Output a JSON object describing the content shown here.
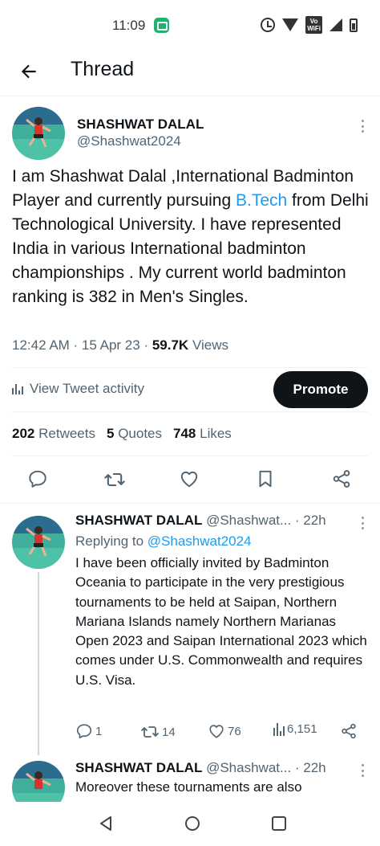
{
  "status_bar": {
    "time": "11:09",
    "vowifi_line1": "Vo",
    "vowifi_line2": "WiFi"
  },
  "header": {
    "title": "Thread"
  },
  "main_tweet": {
    "author_name": "SHASHWAT DALAL",
    "handle": "@Shashwat2024",
    "text_before_link": "I am Shashwat Dalal ,International Badminton Player and currently pursuing ",
    "link_text": "B.Tech",
    "text_after_link": " from Delhi Technological University. I have represented India in various International badminton championships . My current world badminton ranking is 382 in Men's Singles.",
    "timestamp": "12:42 AM · 15 Apr 23 · ",
    "views_count": "59.7K",
    "views_label": "Views",
    "activity_label": "View Tweet activity",
    "promote_label": "Promote",
    "retweets_count": "202",
    "retweets_label": "Retweets",
    "quotes_count": "5",
    "quotes_label": "Quotes",
    "likes_count": "748",
    "likes_label": "Likes"
  },
  "replies": [
    {
      "author_name": "SHASHWAT DALAL",
      "handle_time": "@Shashwat... · 22h",
      "replying_prefix": "Replying to ",
      "replying_handle": "@Shashwat2024",
      "text": "I have been officially invited by Badminton Oceania to participate in the very prestigious tournaments to be held at Saipan, Northern Mariana Islands namely Northern Marianas Open 2023 and Saipan International 2023  which comes under U.S. Commonwealth and requires U.S. Visa.",
      "reply_count": "1",
      "retweet_count": "14",
      "like_count": "76",
      "view_count": "6,151"
    },
    {
      "author_name": "SHASHWAT DALAL",
      "handle_time": "@Shashwat... · 22h",
      "text": "Moreover these tournaments are also"
    }
  ],
  "colors": {
    "accent": "#1d9bf0",
    "text_primary": "#0f1419",
    "text_secondary": "#536471",
    "promote_bg": "#0f1419",
    "divider": "#eff3f4"
  },
  "icons": {
    "back": "arrow-left-icon",
    "more": "more-vertical-icon",
    "reply": "comment-icon",
    "retweet": "retweet-icon",
    "like": "heart-icon",
    "bookmark": "bookmark-icon",
    "share": "share-icon",
    "views": "analytics-icon"
  }
}
